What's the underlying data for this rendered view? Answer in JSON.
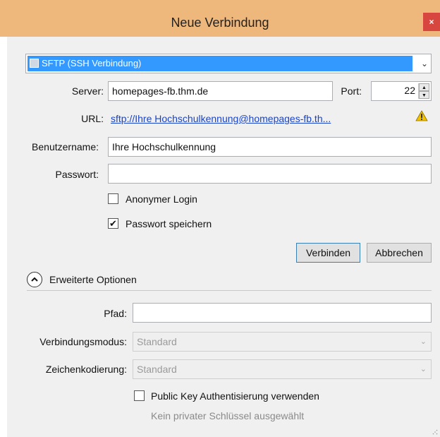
{
  "window": {
    "title": "Neue Verbindung",
    "close_glyph": "×"
  },
  "protocol": {
    "selected": "SFTP (SSH Verbindung)",
    "icon": "protocol-icon"
  },
  "server": {
    "label": "Server:",
    "value": "homepages-fb.thm.de"
  },
  "port": {
    "label": "Port:",
    "value": "22"
  },
  "url": {
    "label": "URL:",
    "value": "sftp://Ihre Hochschulkennung@homepages-fb.th...",
    "warning_icon": "warning-icon"
  },
  "username": {
    "label": "Benutzername:",
    "value": "Ihre Hochschulkennung"
  },
  "password": {
    "label": "Passwort:",
    "value": ""
  },
  "anonymous_login": {
    "label": "Anonymer Login",
    "checked": false
  },
  "save_password": {
    "label": "Passwort speichern",
    "checked": true,
    "mark": "✔"
  },
  "buttons": {
    "connect": "Verbinden",
    "cancel": "Abbrechen"
  },
  "advanced": {
    "label": "Erweiterte Optionen",
    "path": {
      "label": "Pfad:",
      "value": ""
    },
    "connection_mode": {
      "label": "Verbindungsmodus:",
      "value": "Standard"
    },
    "encoding": {
      "label": "Zeichenkodierung:",
      "value": "Standard"
    },
    "public_key": {
      "label": "Public Key Authentisierung verwenden",
      "checked": false
    },
    "no_key_text": "Kein privater Schlüssel ausgewählt"
  },
  "colors": {
    "titlebar": "#eeb87d",
    "close": "#d7463f",
    "selection": "#3399ff",
    "link": "#1a44c8"
  }
}
